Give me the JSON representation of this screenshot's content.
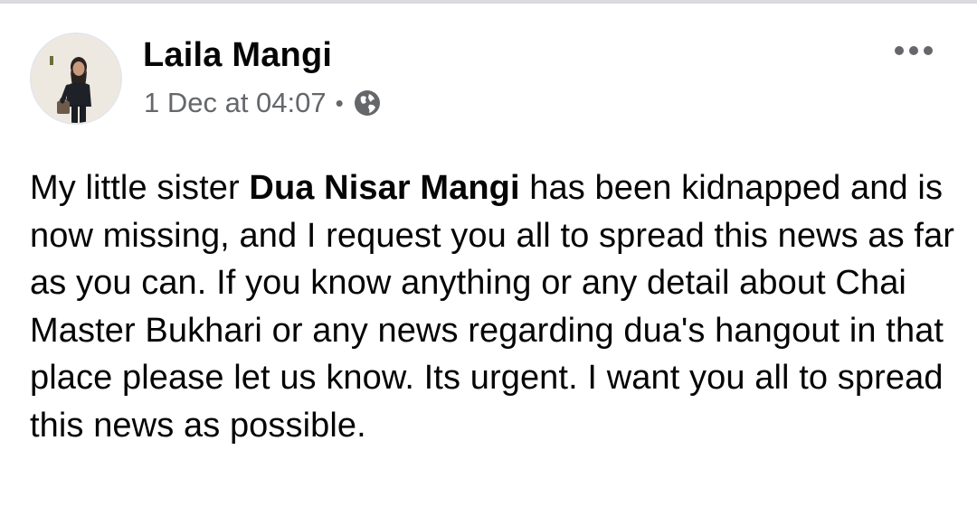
{
  "post": {
    "author": {
      "name": "Laila Mangi",
      "avatar_icon": "profile-photo"
    },
    "timestamp": "1 Dec at 04:07",
    "separator": "•",
    "privacy_icon": "globe-icon",
    "more_icon": "more-options-icon",
    "body": {
      "text_before": "My little sister ",
      "highlighted_name": "Dua Nisar Mangi",
      "text_after": " has been kidnapped and is now missing, and I request you all to spread this news as far as you can. If you know anything or any detail about Chai Master Bukhari or any news regarding dua's hangout in that place please let us know. Its urgent. I want you all to spread this news as possible."
    }
  },
  "colors": {
    "text_primary": "#050505",
    "text_secondary": "#65676b",
    "divider": "#d9dbdf"
  }
}
